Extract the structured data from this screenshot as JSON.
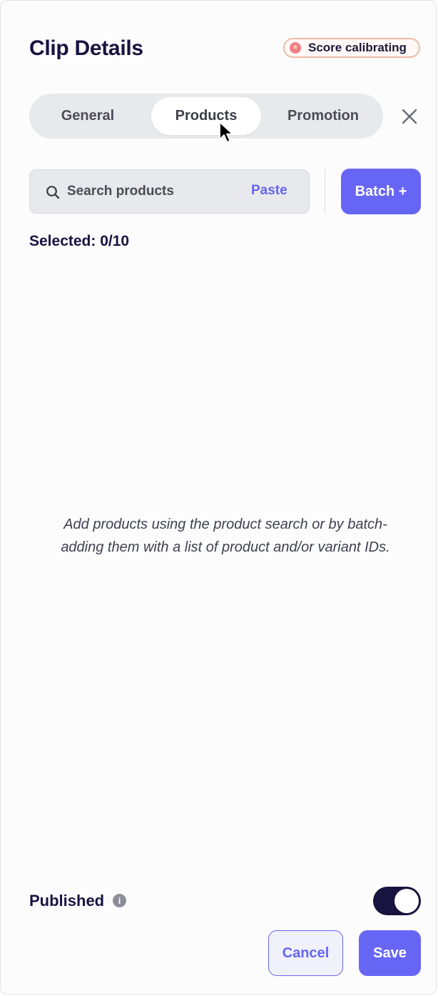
{
  "header": {
    "title": "Clip Details",
    "badge": {
      "icon": "star-icon",
      "label": "Score calibrating"
    }
  },
  "tabs": [
    {
      "label": "General",
      "active": false
    },
    {
      "label": "Products",
      "active": true
    },
    {
      "label": "Promotion",
      "active": false
    }
  ],
  "close_icon": "close-icon",
  "search": {
    "icon": "search-icon",
    "placeholder": "Search products",
    "value": "",
    "paste_label": "Paste"
  },
  "batch_label": "Batch +",
  "selected_text": "Selected: 0/10",
  "empty_message": "Add products using the product search or by batch-adding them with a list of product and/or variant IDs.",
  "footer": {
    "published_label": "Published",
    "info_icon": "info-icon",
    "published_on": true,
    "cancel_label": "Cancel",
    "save_label": "Save"
  },
  "colors": {
    "accent": "#6766f4",
    "dark": "#171440",
    "badge_border": "#f0b9a5"
  }
}
